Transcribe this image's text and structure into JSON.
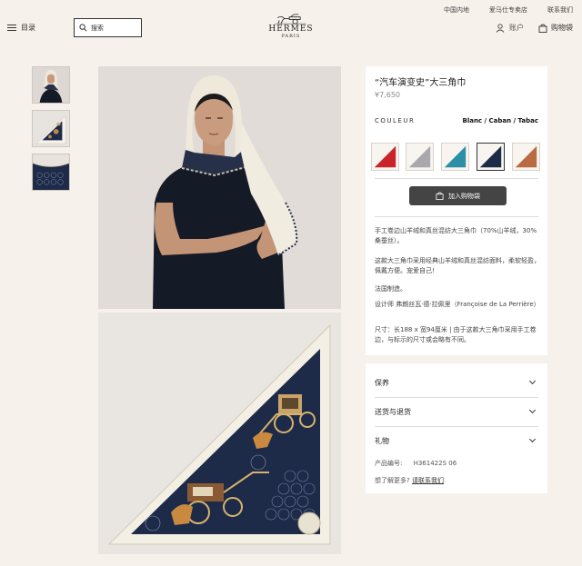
{
  "utility_links": [
    "中国内地",
    "爱马仕专卖店",
    "联系我们"
  ],
  "header": {
    "menu_label": "目录",
    "search_placeholder": "搜索",
    "logo_text": "HERMES",
    "logo_city": "PARIS",
    "account_label": "账户",
    "bag_label": "购物袋"
  },
  "product": {
    "title": "“汽车演变史”大三角巾",
    "price": "¥7,650",
    "couleur_label": "Couleur",
    "color_name": "Blanc / Caban / Tabac",
    "swatches": [
      {
        "name": "swatch-red",
        "fill": "#c9242a"
      },
      {
        "name": "swatch-grey",
        "fill": "#a9a9ad"
      },
      {
        "name": "swatch-teal",
        "fill": "#2b8fa8"
      },
      {
        "name": "swatch-navy",
        "fill": "#1e2b48"
      },
      {
        "name": "swatch-tan",
        "fill": "#b96b44"
      }
    ],
    "add_to_bag": "加入购物袋",
    "description": {
      "line1": "手工卷边山羊绒和真丝混纺大三角巾（70%山羊绒，30%桑蚕丝）。",
      "line2": "这款大三角巾采用经典山羊绒和真丝混纺面料，柔软轻盈，佩戴方便。宠爱自己!",
      "line3": "法国制造。",
      "line4": "设计师 弗朗丝瓦·德·拉佩里（Françoise de La Perrière）",
      "line5": "尺寸：长188 x 宽94厘米 | 由于这款大三角巾采用手工卷边，与标示的尺寸或会略有不同。"
    },
    "accordion": [
      "保养",
      "送货与退货",
      "礼物"
    ],
    "sku_label": "产品编号:",
    "sku_value": "H361422S 06",
    "help_text": "想了解更多?",
    "help_link": "请联系我们"
  },
  "colors": {
    "background": "#f6f1eb",
    "panel": "#ffffff",
    "button": "#444444",
    "scarf_navy": "#1e2b48"
  }
}
